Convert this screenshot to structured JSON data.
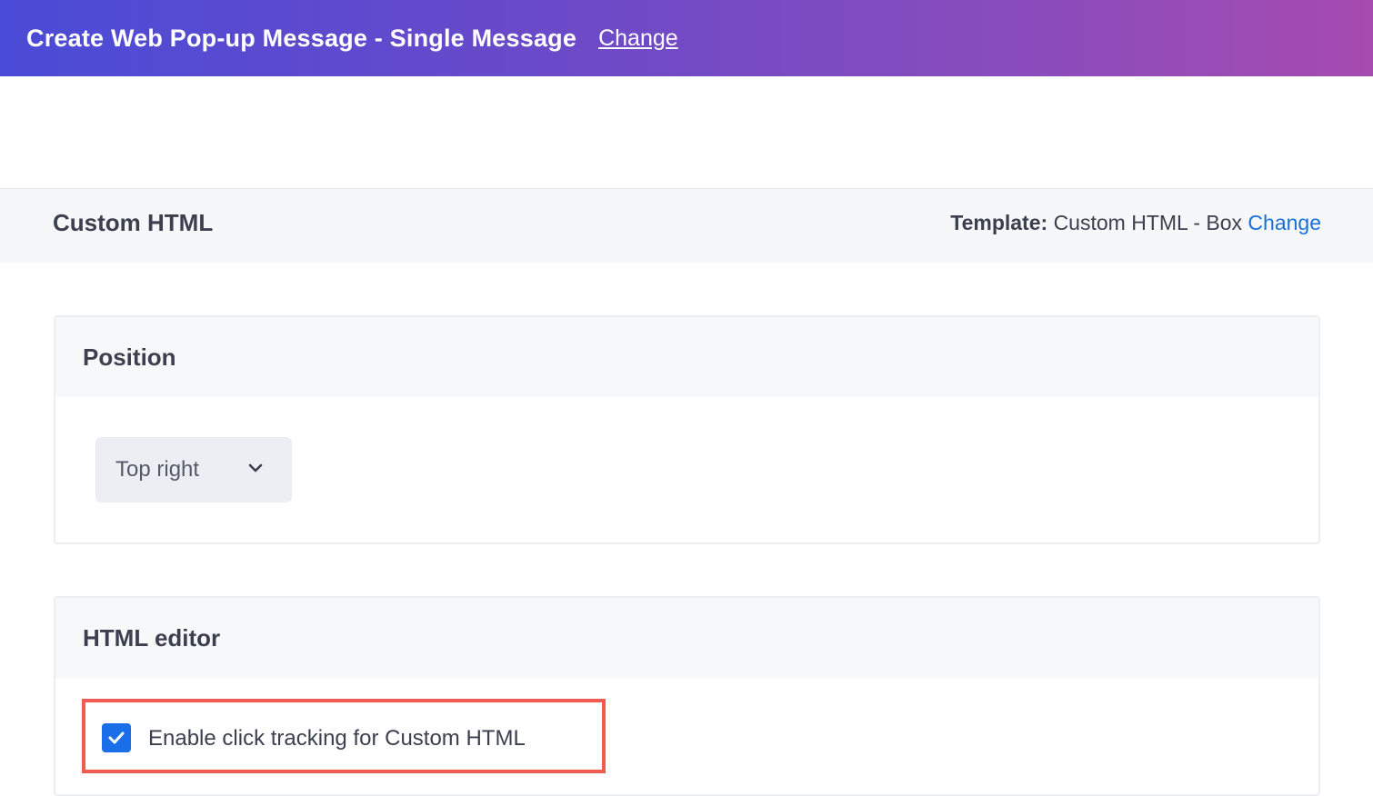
{
  "header": {
    "title": "Create Web Pop-up Message - Single Message",
    "change_link": "Change",
    "gradient_colors": [
      "#4a4bd6",
      "#a64bb0"
    ]
  },
  "subheader": {
    "title": "Custom HTML",
    "template_label": "Template:",
    "template_value": "Custom HTML - Box",
    "template_change_link": "Change"
  },
  "position_section": {
    "title": "Position",
    "select": {
      "selected": "Top right",
      "icon": "chevron-down-icon"
    }
  },
  "editor_section": {
    "title": "HTML editor",
    "click_tracking": {
      "label": "Enable click tracking for Custom HTML",
      "checked": true,
      "icon": "checkmark-icon"
    },
    "highlight_color": "#f25c4f"
  },
  "colors": {
    "link": "#1a6fd8",
    "checkbox": "#1a6fe8",
    "text": "#3b3f4e"
  }
}
